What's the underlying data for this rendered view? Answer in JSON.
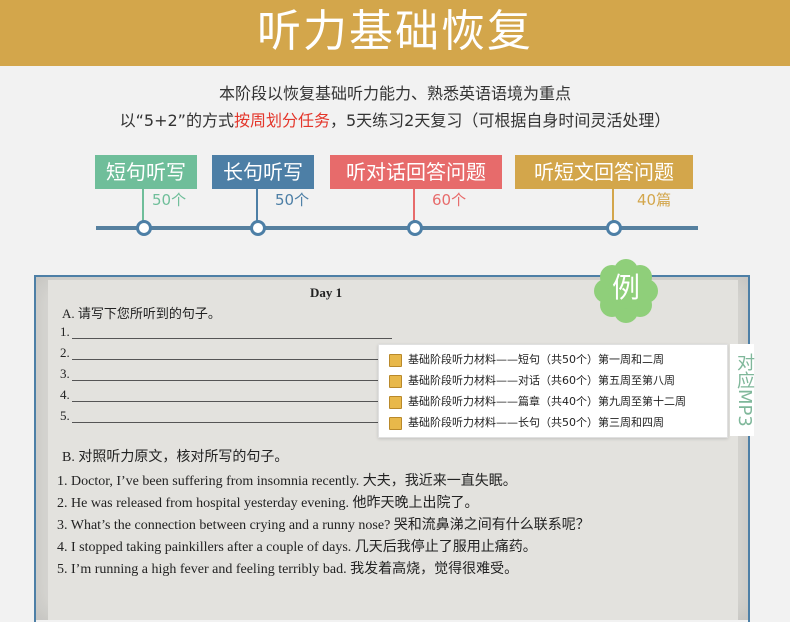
{
  "banner": {
    "title": "听力基础恢复"
  },
  "intro": {
    "line1": "本阶段以恢复基础听力能力、熟悉英语语境为重点",
    "line2_before": "以“5+2”的方式",
    "line2_highlight": "按周划分任务",
    "line2_after": "，5天练习2天复习（可根据自身时间灵活处理）"
  },
  "tags": [
    {
      "label": "短句听写",
      "count": "50个",
      "color": "#6fbe9a"
    },
    {
      "label": "长句听写",
      "count": "50个",
      "color": "#4d7fa6"
    },
    {
      "label": "听对话回答问题",
      "count": "60个",
      "color": "#e76b6b"
    },
    {
      "label": "听短文回答问题",
      "count": "40篇",
      "color": "#d3a64b"
    }
  ],
  "example_badge": "例",
  "document": {
    "day": "Day 1",
    "section_a": "A. 请写下您所听到的句子。",
    "blanks": [
      "1.",
      "2.",
      "3.",
      "4.",
      "5."
    ],
    "section_b": "B. 对照听力原文，核对所写的句子。",
    "sentences": [
      "1. Doctor, I’ve been suffering from insomnia recently. 大夫，我近来一直失眠。",
      "2. He was released from hospital yesterday evening. 他昨天晚上出院了。",
      "3. What’s the connection between crying and a runny nose? 哭和流鼻涕之间有什么联系呢？",
      "4. I stopped taking painkillers after a couple of days. 几天后我停止了服用止痛药。",
      "5. I’m running a high fever and feeling terribly bad. 我发着高烧，觉得很难受。"
    ]
  },
  "files": [
    "基础阶段听力材料——短句（共50个）第一周和二周",
    "基础阶段听力材料——对话（共60个）第五周至第八周",
    "基础阶段听力材料——篇章（共40个）第九周至第十二周",
    "基础阶段听力材料——长句（共50个）第三周和四周"
  ],
  "side_note": "对应MP3"
}
